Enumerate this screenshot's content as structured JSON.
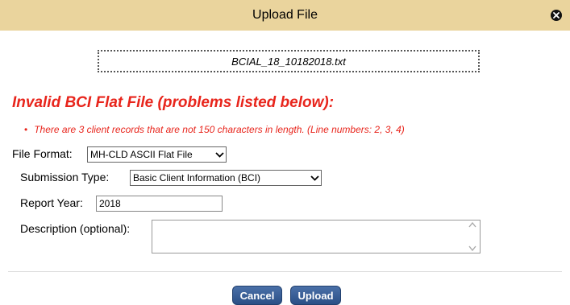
{
  "dialog": {
    "title": "Upload File",
    "close_icon": "close-circle-icon",
    "file_name": "BCIAL_18_10182018.txt"
  },
  "errors": {
    "title": "Invalid BCI Flat File (problems listed below):",
    "items": [
      "There are 3 client records that are not 150 characters in length. (Line numbers: 2, 3, 4)"
    ],
    "color": "#e8251c"
  },
  "form": {
    "file_format": {
      "label": "File Format:",
      "value": "MH-CLD ASCII Flat File"
    },
    "submission_type": {
      "label": "Submission Type:",
      "value": "Basic Client Information (BCI)"
    },
    "report_year": {
      "label": "Report Year:",
      "value": "2018"
    },
    "description": {
      "label": "Description (optional):",
      "value": ""
    }
  },
  "buttons": {
    "cancel": "Cancel",
    "upload": "Upload"
  },
  "colors": {
    "titlebar": "#ead49d",
    "button": "#2a4f86"
  }
}
